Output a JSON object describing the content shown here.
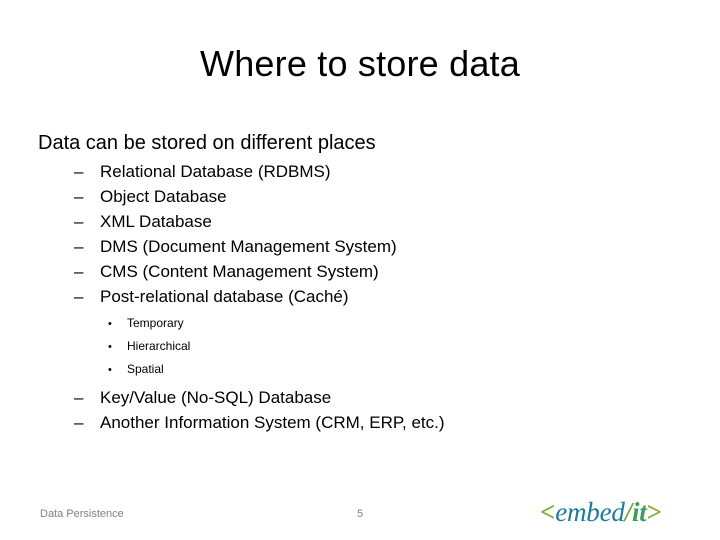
{
  "slide": {
    "title": "Where to store data",
    "level1": "Data can be stored on different places",
    "items_before": [
      {
        "marker": "–",
        "label": "Relational Database (RDBMS)"
      },
      {
        "marker": "–",
        "label": "Object Database"
      },
      {
        "marker": "–",
        "label": "XML Database"
      },
      {
        "marker": "–",
        "label": "DMS (Document Management System)"
      },
      {
        "marker": "–",
        "label": "CMS (Content Management System)"
      },
      {
        "marker": "–",
        "label": "Post-relational database (Caché)"
      }
    ],
    "subitems": [
      {
        "marker": "•",
        "label": "Temporary"
      },
      {
        "marker": "•",
        "label": "Hierarchical"
      },
      {
        "marker": "•",
        "label": "Spatial"
      }
    ],
    "items_after": [
      {
        "marker": "–",
        "label": "Key/Value (No-SQL) Database"
      },
      {
        "marker": "–",
        "label": "Another Information System (CRM, ERP, etc.)"
      }
    ]
  },
  "footer": {
    "left_text": "Data Persistence",
    "page_number": "5"
  },
  "logo": {
    "open_bracket": "<",
    "word": "embed",
    "slash": "/",
    "it": "it",
    "close_bracket": ">",
    "bracket_color": "#8aa832",
    "word_color": "#1c7a9c",
    "it_color": "#3f9c5a"
  }
}
